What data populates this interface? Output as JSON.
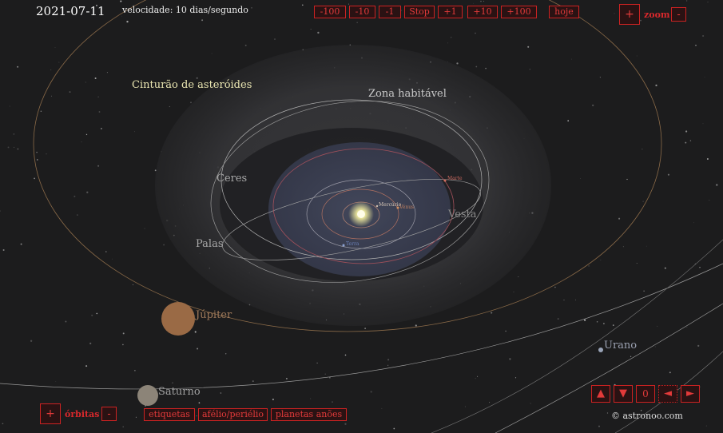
{
  "header": {
    "date": "2021-07-11",
    "speed": "velocidade: 10 dias/segundo"
  },
  "speed_controls": {
    "minus100": "-100",
    "minus10": "-10",
    "minus1": "-1",
    "stop": "Stop",
    "plus1": "+1",
    "plus10": "+10",
    "plus100": "+100",
    "today": "hoje"
  },
  "zoom": {
    "plus": "+",
    "label": "zoom",
    "minus": "-"
  },
  "orbits": {
    "plus": "+",
    "label": "órbitas",
    "minus": "-"
  },
  "toggles": {
    "labels": "etiquetas",
    "aphelion": "afélio/periélio",
    "dwarf": "planetas anões"
  },
  "view_controls": {
    "up": "▲",
    "down": "▼",
    "angle": "0",
    "left": "◄",
    "right": "►"
  },
  "copyright": "© astronoo.com",
  "regions": {
    "asteroid_belt": "Cinturão de asteróides",
    "habitable_zone": "Zona habitável"
  },
  "bodies": {
    "ceres": "Ceres",
    "palas": "Palas",
    "vesta": "Vesta",
    "jupiter": "Júpiter",
    "saturno": "Saturno",
    "urano": "Urano",
    "marte": "Marte",
    "mercurio": "Mercúrio",
    "venus": "Vénus",
    "terra": "Terra"
  },
  "colors": {
    "button_border": "#cc2222",
    "button_text": "#e23a3a",
    "sun": "#fff9c0",
    "jupiter": "#9a6a45",
    "saturno": "#8c8478"
  }
}
